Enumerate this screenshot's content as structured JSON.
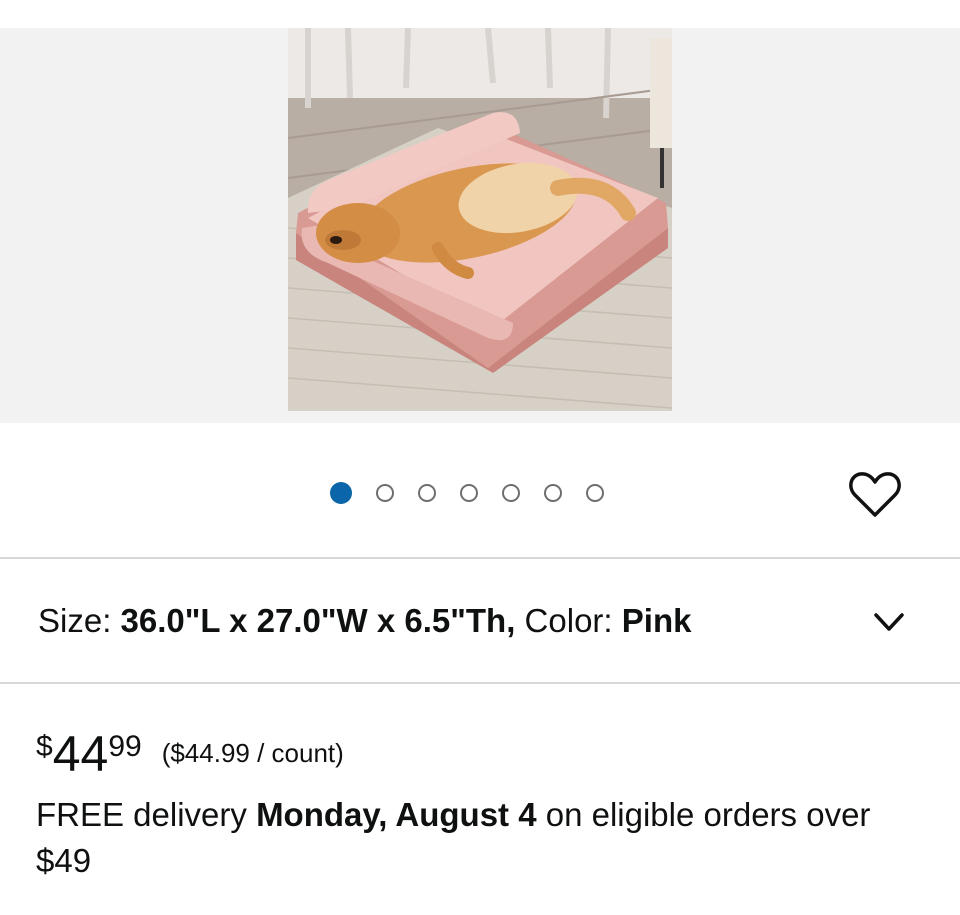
{
  "gallery": {
    "image_description_icon": "dog-on-pink-bolster-bed-photo",
    "dots": [
      {
        "active": true
      },
      {
        "active": false
      },
      {
        "active": false
      },
      {
        "active": false
      },
      {
        "active": false
      },
      {
        "active": false
      },
      {
        "active": false
      }
    ],
    "active_dot_color": "#0a66a8",
    "wishlist_icon": "heart-outline-icon"
  },
  "variation": {
    "size_label": "Size: ",
    "size_value": "36.0\"L x 27.0\"W x 6.5\"Th,",
    "color_label": " Color: ",
    "color_value": "Pink",
    "expand_icon": "chevron-down-icon"
  },
  "price": {
    "currency": "$",
    "whole": "44",
    "fraction": "99",
    "unit_price": "($44.99 / count)"
  },
  "delivery": {
    "prefix": "FREE delivery ",
    "date": "Monday, August 4",
    "suffix": " on eligible orders over $49"
  }
}
